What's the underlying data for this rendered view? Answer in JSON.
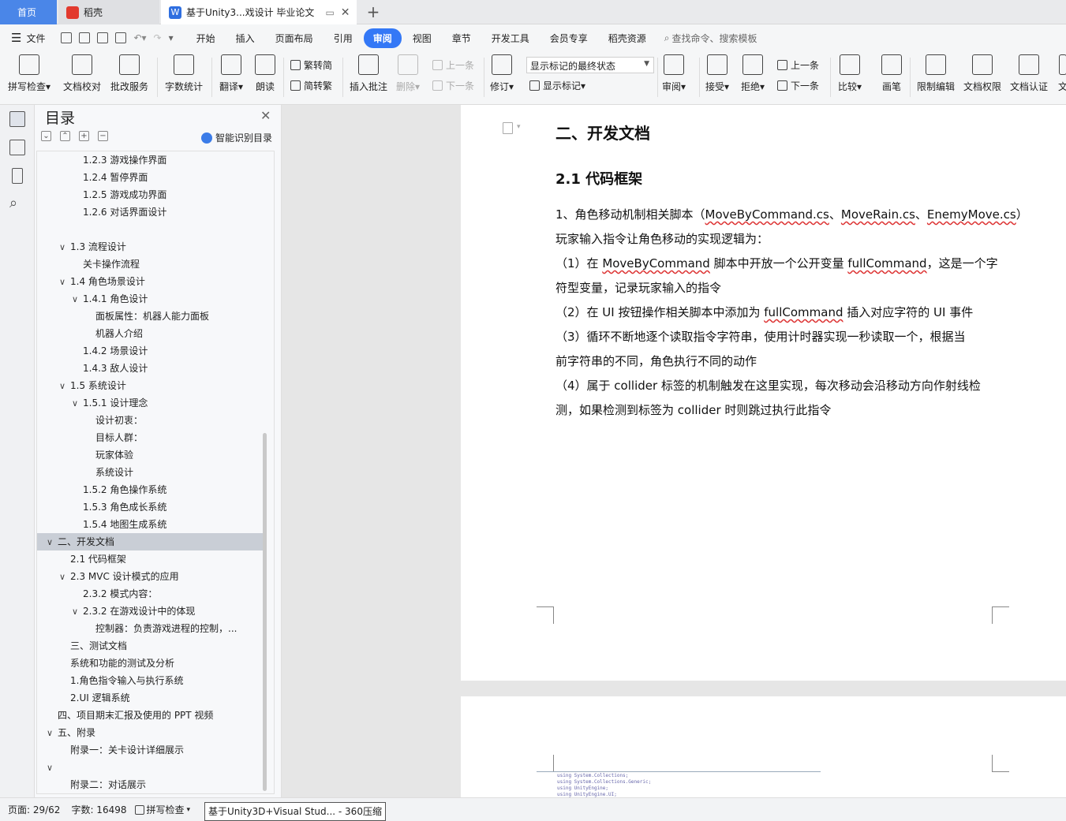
{
  "tabs": {
    "home": "首页",
    "daoke": "稻壳",
    "doc": "基于Unity3...戏设计 毕业论文"
  },
  "menubar": {
    "file": "文件",
    "tabs": [
      "开始",
      "插入",
      "页面布局",
      "引用",
      "审阅",
      "视图",
      "章节",
      "开发工具",
      "会员专享",
      "稻壳资源"
    ],
    "active_tab": "审阅",
    "search": "查找命令、搜索模板"
  },
  "ribbon": {
    "spell": "拼写检查",
    "proof": "文档校对",
    "annotate_service": "批改服务",
    "wordcount": "字数统计",
    "translate": "翻译",
    "read": "朗读",
    "trad_simp": "繁转简",
    "simp_trad": "简转繁",
    "insert_comment": "插入批注",
    "delete": "删除",
    "prev_comment": "上一条",
    "next_comment": "下一条",
    "revise": "修订",
    "markup_state": "显示标记的最终状态",
    "show_markup": "显示标记",
    "review": "审阅",
    "accept": "接受",
    "reject": "拒绝",
    "prev_change": "上一条",
    "next_change": "下一条",
    "compare": "比较",
    "pen": "画笔",
    "restrict_edit": "限制编辑",
    "doc_permission": "文档权限",
    "doc_cert": "文档认证",
    "trailing": "文"
  },
  "nav": {
    "title": "目录",
    "smart": "智能识别目录",
    "items": [
      {
        "text": "1.2.3 游戏操作界面",
        "level": 3,
        "car": ""
      },
      {
        "text": "1.2.4 暂停界面",
        "level": 3,
        "car": ""
      },
      {
        "text": "1.2.5 游戏成功界面",
        "level": 3,
        "car": ""
      },
      {
        "text": "1.2.6 对话界面设计",
        "level": 3,
        "car": ""
      },
      {
        "text": "",
        "level": 3,
        "car": ""
      },
      {
        "text": "1.3 流程设计",
        "level": 2,
        "car": "⌄"
      },
      {
        "text": "关卡操作流程",
        "level": 3,
        "car": ""
      },
      {
        "text": "1.4 角色场景设计",
        "level": 2,
        "car": "⌄"
      },
      {
        "text": "1.4.1 角色设计",
        "level": 3,
        "car": "⌄"
      },
      {
        "text": "面板属性：机器人能力面板",
        "level": 4,
        "car": ""
      },
      {
        "text": "机器人介绍",
        "level": 4,
        "car": ""
      },
      {
        "text": "1.4.2 场景设计",
        "level": 3,
        "car": ""
      },
      {
        "text": "1.4.3 敌人设计",
        "level": 3,
        "car": ""
      },
      {
        "text": "1.5 系统设计",
        "level": 2,
        "car": "⌄"
      },
      {
        "text": "1.5.1 设计理念",
        "level": 3,
        "car": "⌄"
      },
      {
        "text": "设计初衷：",
        "level": 4,
        "car": ""
      },
      {
        "text": "目标人群：",
        "level": 4,
        "car": ""
      },
      {
        "text": "玩家体验",
        "level": 4,
        "car": ""
      },
      {
        "text": "系统设计",
        "level": 4,
        "car": ""
      },
      {
        "text": "1.5.2 角色操作系统",
        "level": 3,
        "car": ""
      },
      {
        "text": "1.5.3 角色成长系统",
        "level": 3,
        "car": ""
      },
      {
        "text": "1.5.4 地图生成系统",
        "level": 3,
        "car": ""
      },
      {
        "text": "二、开发文档",
        "level": 1,
        "car": "⌄",
        "active": true
      },
      {
        "text": "2.1 代码框架",
        "level": 2,
        "car": ""
      },
      {
        "text": "2.3 MVC 设计模式的应用",
        "level": 2,
        "car": "⌄"
      },
      {
        "text": "2.3.2 模式内容：",
        "level": 3,
        "car": ""
      },
      {
        "text": "2.3.2 在游戏设计中的体现",
        "level": 3,
        "car": "⌄"
      },
      {
        "text": "控制器：负责游戏进程的控制，...",
        "level": 4,
        "car": ""
      },
      {
        "text": "三、测试文档",
        "level": 2,
        "car": ""
      },
      {
        "text": "系统和功能的测试及分析",
        "level": 2,
        "car": ""
      },
      {
        "text": "1.角色指令输入与执行系统",
        "level": 2,
        "car": ""
      },
      {
        "text": "2.UI 逻辑系统",
        "level": 2,
        "car": ""
      },
      {
        "text": "四、项目期末汇报及使用的 PPT 视频",
        "level": 1,
        "car": ""
      },
      {
        "text": "五、附录",
        "level": 1,
        "car": "⌄"
      },
      {
        "text": "附录一：关卡设计详细展示",
        "level": 2,
        "car": ""
      },
      {
        "text": "",
        "level": 1,
        "car": "⌄"
      },
      {
        "text": "附录二：对话展示",
        "level": 2,
        "car": ""
      }
    ]
  },
  "doc": {
    "h1": "二、开发文档",
    "h2": "2.1 代码框架",
    "p1a": "1、角色移动机制相关脚本（",
    "p1_s1": "MoveByCommand.cs",
    "p1_sep1": "、",
    "p1_s2": "MoveRain.cs",
    "p1_sep2": "、",
    "p1_s3": "EnemyMove.cs",
    "p1b": "）",
    "p2": "玩家输入指令让角色移动的实现逻辑为：",
    "p3a": "（1）在 ",
    "p3_s1": "MoveByCommand",
    "p3b": " 脚本中开放一个公开变量 ",
    "p3_s2": "fullCommand",
    "p3c": "，这是一个字",
    "p4": "符型变量，记录玩家输入的指令",
    "p5a": "（2）在 UI 按钮操作相关脚本中添加为 ",
    "p5_s1": "fullCommand",
    "p5b": " 插入对应字符的 UI 事件",
    "p6": "（3）循环不断地逐个读取指令字符串，使用计时器实现一秒读取一个，根据当",
    "p7": "前字符串的不同，角色执行不同的动作",
    "p8": "（4）属于 collider 标签的机制触发在这里实现，每次移动会沿移动方向作射线检",
    "p9": "测，如果检测到标签为 collider 时则跳过执行此指令",
    "code": [
      "using System.Collections;",
      "using System.Collections.Generic;",
      "using UnityEngine;",
      "using UnityEngine.UI;"
    ]
  },
  "status": {
    "page": "页面: 29/62",
    "words": "字数: 16498",
    "spell": "拼写检查",
    "tooltip": "基于Unity3D+Visual Stud... - 360压缩"
  },
  "colors": {
    "accent": "#3478f6",
    "home_tab": "#4a86e8",
    "daoke_red": "#e23a2e",
    "wps_blue": "#2f6fe0"
  }
}
